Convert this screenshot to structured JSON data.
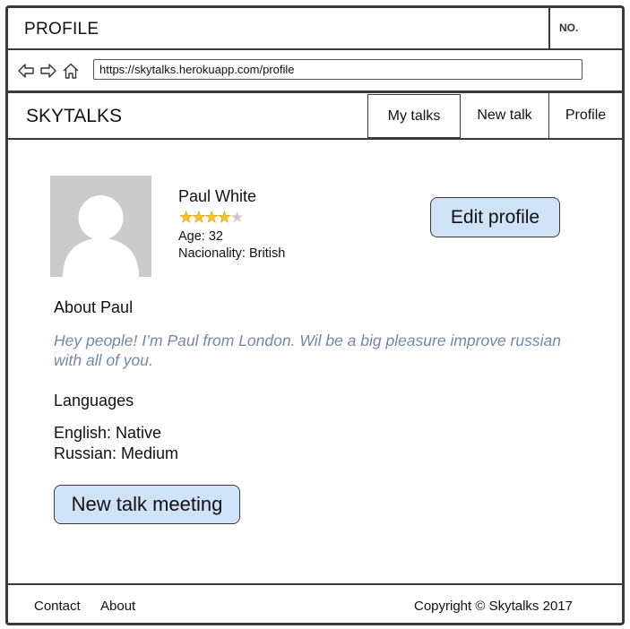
{
  "window": {
    "title": "PROFILE",
    "number_label": "NO."
  },
  "browser": {
    "url": "https://skytalks.herokuapp.com/profile",
    "icons": [
      "back-arrow-icon",
      "forward-arrow-icon",
      "home-icon"
    ]
  },
  "header": {
    "brand": "SKYTALKS",
    "tabs": [
      {
        "label": "My talks",
        "active": true
      },
      {
        "label": "New talk",
        "active": false
      },
      {
        "label": "Profile",
        "active": false
      }
    ]
  },
  "profile": {
    "name": "Paul White",
    "rating": 4,
    "rating_max": 5,
    "age": "Age: 32",
    "nationality": "Nacionality: British",
    "edit_button": "Edit profile",
    "avatar_icon": "user-placeholder-icon"
  },
  "about": {
    "heading": "About Paul",
    "text": "Hey people! I’m Paul from London. Wil be a big pleasure improve russian with all of you."
  },
  "languages": {
    "heading": "Languages",
    "items": [
      "English: Native",
      "Russian: Medium"
    ]
  },
  "actions": {
    "new_meeting_button": "New talk meeting"
  },
  "footer": {
    "contact": "Contact",
    "about": "About",
    "copyright": "Copyright © Skytalks 2017"
  },
  "colors": {
    "button_fill": "#cfe2f7",
    "about_text": "#7388a8",
    "star_on": "#f4c430",
    "star_off": "#c8c8c8",
    "avatar_bg": "#cbcbcb",
    "frame": "#3a3a3a"
  }
}
